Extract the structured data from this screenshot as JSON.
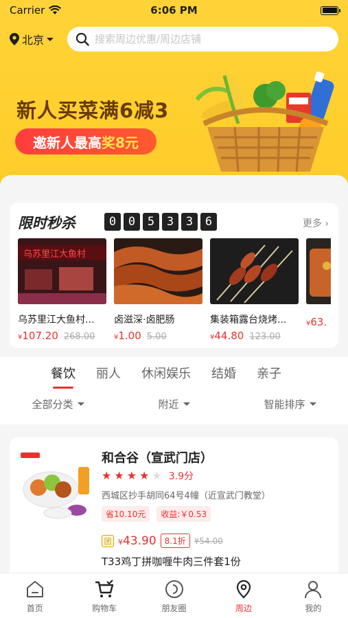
{
  "status_bar": {
    "carrier": "Carrier",
    "time": "6:06 PM"
  },
  "header": {
    "city": "北京",
    "search_placeholder": "搜索周边优惠/周边店铺"
  },
  "banner": {
    "title": "新人买菜满6减3",
    "pill_text": "邀新人最高",
    "pill_highlight": "奖8元"
  },
  "flash_sale": {
    "title": "限时秒杀",
    "countdown": [
      "0",
      "0",
      "5",
      "3",
      "3",
      "6"
    ],
    "more": "更多",
    "items": [
      {
        "name": "乌苏里江大鱼村...",
        "currency": "¥",
        "price": "107.20",
        "old_price": "268.00"
      },
      {
        "name": "卤滋深·卤肥肠",
        "currency": "¥",
        "price": "1.00",
        "old_price": "5.00"
      },
      {
        "name": "集装箱露台烧烤...",
        "currency": "¥",
        "price": "44.80",
        "old_price": "123.00"
      },
      {
        "name": "",
        "currency": "¥",
        "price": "63.",
        "old_price": ""
      }
    ]
  },
  "categories": {
    "tabs": [
      "餐饮",
      "丽人",
      "休闲娱乐",
      "结婚",
      "亲子"
    ],
    "active": "餐饮",
    "filters": [
      "全部分类",
      "附近",
      "智能排序"
    ]
  },
  "shop": {
    "name": "和合谷（宣武门店）",
    "rating_stars": 4,
    "score": "3.9分",
    "address": "西城区抄手胡同64号4幢（近宣武门教堂）",
    "tags": [
      "省10.10元",
      "收益:￥0.53"
    ],
    "deal": {
      "badge": "团",
      "currency": "¥",
      "price": "43.90",
      "discount": "8.1折",
      "old_price": "¥54.00",
      "name": "T33鸡丁拼咖喱牛肉三件套1份"
    }
  },
  "tabbar": {
    "items": [
      "首页",
      "购物车",
      "朋友圈",
      "周边",
      "我的"
    ],
    "active": "周边"
  },
  "colors": {
    "accent": "#e8322f",
    "brand_yellow": "#ffd338"
  }
}
